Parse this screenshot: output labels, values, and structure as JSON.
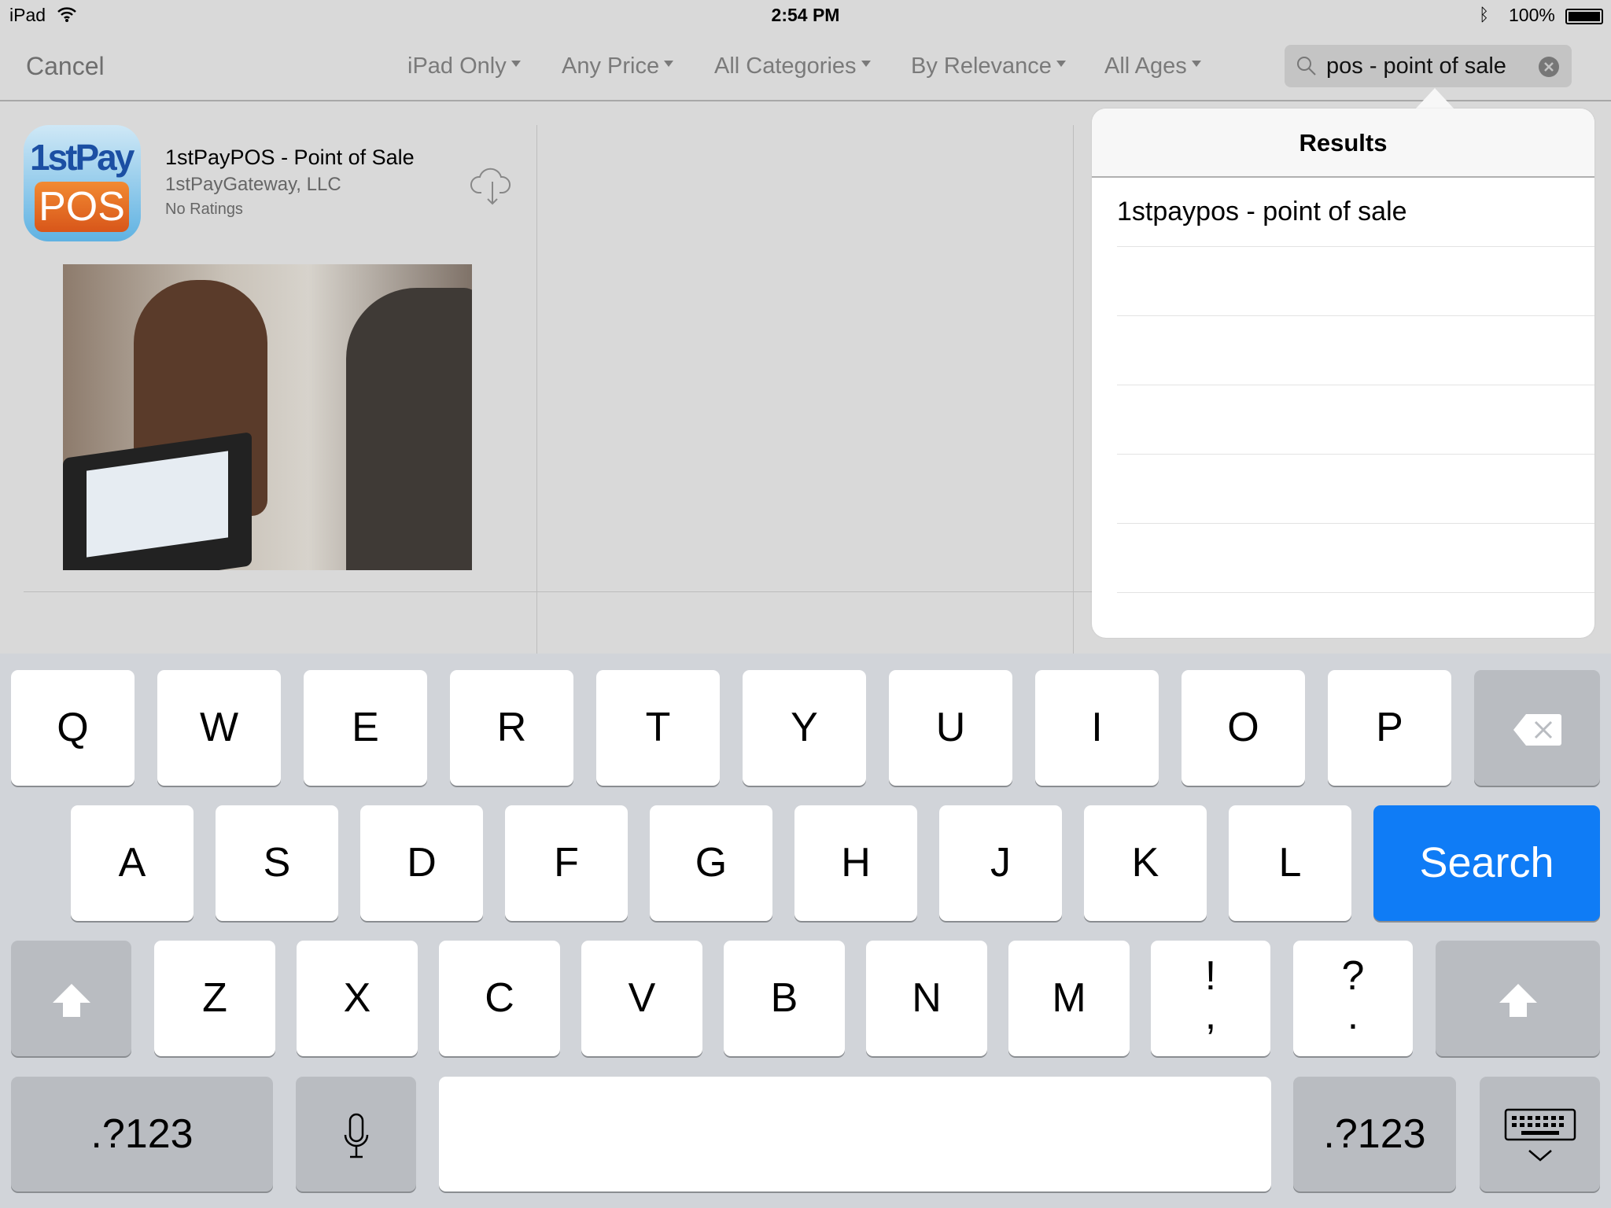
{
  "status_bar": {
    "device": "iPad",
    "time": "2:54 PM",
    "battery": "100%"
  },
  "nav": {
    "cancel": "Cancel",
    "filters": [
      "iPad Only",
      "Any Price",
      "All Categories",
      "By Relevance",
      "All Ages"
    ],
    "search_value": "pos - point of sale"
  },
  "results": {
    "title": "Results",
    "items": [
      "1stpaypos - point of sale"
    ]
  },
  "app": {
    "name": "1stPayPOS - Point of Sale",
    "developer": "1stPayGateway, LLC",
    "rating": "No Ratings",
    "icon_text_top": "1stPay",
    "icon_text_bottom": "POS"
  },
  "keyboard": {
    "row1": [
      "Q",
      "W",
      "E",
      "R",
      "T",
      "Y",
      "U",
      "I",
      "O",
      "P"
    ],
    "row2": [
      "A",
      "S",
      "D",
      "F",
      "G",
      "H",
      "J",
      "K",
      "L"
    ],
    "row3": [
      "Z",
      "X",
      "C",
      "V",
      "B",
      "N",
      "M"
    ],
    "punct1": [
      "!",
      ","
    ],
    "punct2": [
      "?",
      "."
    ],
    "search": "Search",
    "numbers": ".?123",
    "accent_color": "#0f7cf6"
  }
}
